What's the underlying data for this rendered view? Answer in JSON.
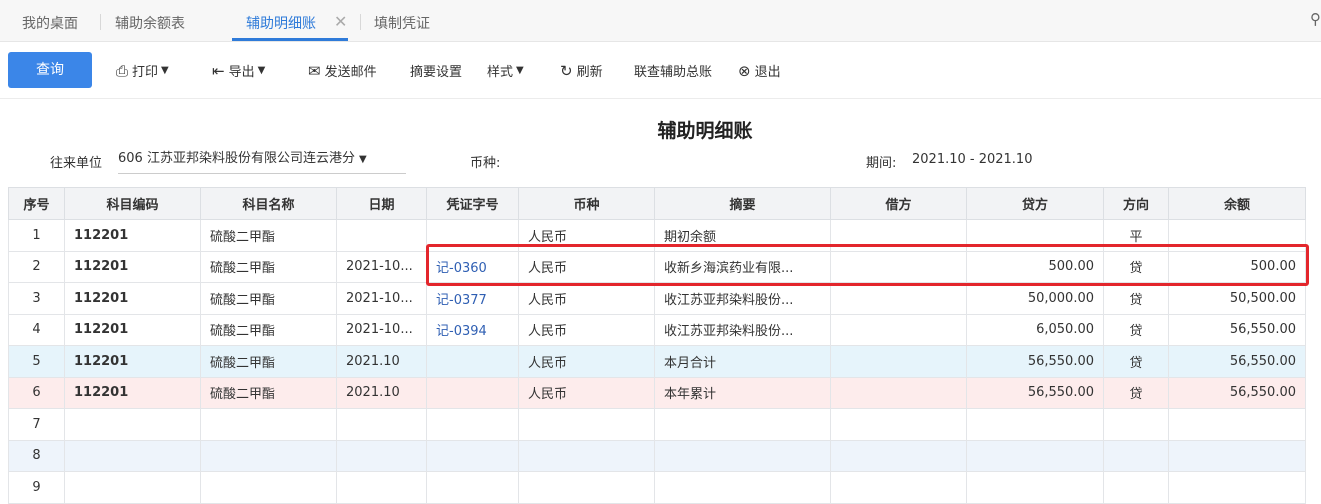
{
  "tabs": [
    {
      "label": "我的桌面"
    },
    {
      "label": "辅助余额表"
    },
    {
      "label": "辅助明细账"
    },
    {
      "label": "填制凭证"
    }
  ],
  "toolbar": {
    "query": "查询",
    "print": "打印",
    "export": "导出",
    "email": "发送邮件",
    "summary_settings": "摘要设置",
    "style": "样式",
    "refresh": "刷新",
    "linked_ledger": "联查辅助总账",
    "exit": "退出"
  },
  "report": {
    "title": "辅助明细账",
    "unit_label": "往来单位",
    "unit_value": "606 江苏亚邦染料股份有限公司连云港分",
    "currency_label": "币种:",
    "period_label": "期间:",
    "period_value": "2021.10 - 2021.10"
  },
  "columns": [
    "序号",
    "科目编码",
    "科目名称",
    "日期",
    "凭证字号",
    "币种",
    "摘要",
    "借方",
    "贷方",
    "方向",
    "余额"
  ],
  "rows": [
    {
      "no": "1",
      "code": "112201",
      "name": "硫酸二甲酯",
      "date": "",
      "voucher": "",
      "currency": "人民币",
      "summary": "期初余额",
      "debit": "",
      "credit": "",
      "dir": "平",
      "balance": ""
    },
    {
      "no": "2",
      "code": "112201",
      "name": "硫酸二甲酯",
      "date": "2021-10...",
      "voucher": "记-0360",
      "currency": "人民币",
      "summary": "收新乡海滨药业有限...",
      "debit": "",
      "credit": "500.00",
      "dir": "贷",
      "balance": "500.00"
    },
    {
      "no": "3",
      "code": "112201",
      "name": "硫酸二甲酯",
      "date": "2021-10...",
      "voucher": "记-0377",
      "currency": "人民币",
      "summary": "收江苏亚邦染料股份...",
      "debit": "",
      "credit": "50,000.00",
      "dir": "贷",
      "balance": "50,500.00"
    },
    {
      "no": "4",
      "code": "112201",
      "name": "硫酸二甲酯",
      "date": "2021-10...",
      "voucher": "记-0394",
      "currency": "人民币",
      "summary": "收江苏亚邦染料股份...",
      "debit": "",
      "credit": "6,050.00",
      "dir": "贷",
      "balance": "56,550.00"
    },
    {
      "no": "5",
      "code": "112201",
      "name": "硫酸二甲酯",
      "date": "2021.10",
      "voucher": "",
      "currency": "人民币",
      "summary": "本月合计",
      "debit": "",
      "credit": "56,550.00",
      "dir": "贷",
      "balance": "56,550.00"
    },
    {
      "no": "6",
      "code": "112201",
      "name": "硫酸二甲酯",
      "date": "2021.10",
      "voucher": "",
      "currency": "人民币",
      "summary": "本年累计",
      "debit": "",
      "credit": "56,550.00",
      "dir": "贷",
      "balance": "56,550.00"
    },
    {
      "no": "7",
      "code": "",
      "name": "",
      "date": "",
      "voucher": "",
      "currency": "",
      "summary": "",
      "debit": "",
      "credit": "",
      "dir": "",
      "balance": ""
    },
    {
      "no": "8",
      "code": "",
      "name": "",
      "date": "",
      "voucher": "",
      "currency": "",
      "summary": "",
      "debit": "",
      "credit": "",
      "dir": "",
      "balance": ""
    },
    {
      "no": "9",
      "code": "",
      "name": "",
      "date": "",
      "voucher": "",
      "currency": "",
      "summary": "",
      "debit": "",
      "credit": "",
      "dir": "",
      "balance": ""
    }
  ],
  "colors": {
    "accent": "#2f7bd9",
    "query_button": "#3b86e8",
    "highlight": "#e3262c",
    "subtotal_row": "#e6f4fb",
    "total_row": "#fdecec"
  }
}
